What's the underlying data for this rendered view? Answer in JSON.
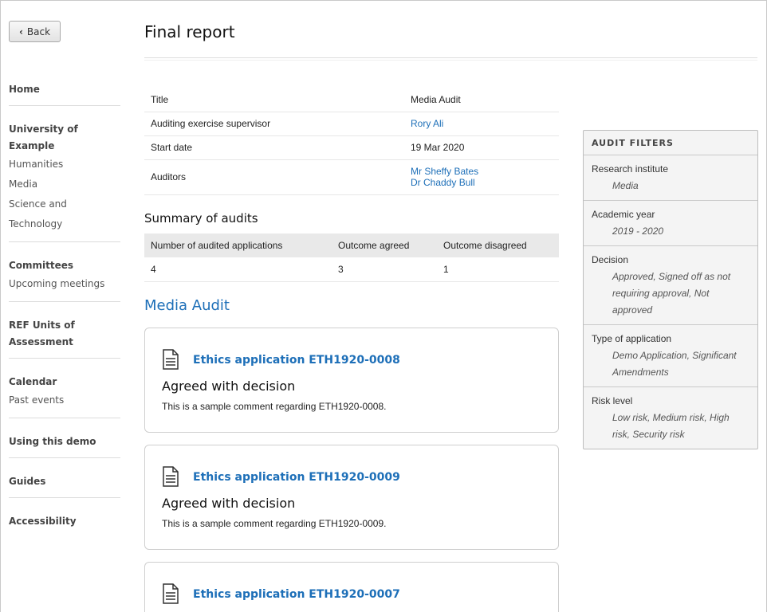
{
  "back": {
    "label": "Back"
  },
  "sidebar": {
    "home": "Home",
    "university": {
      "heading": "University of Example",
      "links": [
        "Humanities",
        "Media",
        "Science and Technology"
      ]
    },
    "committees": {
      "heading": "Committees",
      "links": [
        "Upcoming meetings"
      ]
    },
    "ref_units": "REF Units of Assessment",
    "calendar": {
      "heading": "Calendar",
      "links": [
        "Past events"
      ]
    },
    "using_demo": "Using this demo",
    "guides": "Guides",
    "accessibility": "Accessibility"
  },
  "page": {
    "title": "Final report"
  },
  "details": {
    "title_label": "Title",
    "title_value": "Media Audit",
    "supervisor_label": "Auditing exercise supervisor",
    "supervisor_value": "Rory Ali",
    "start_label": "Start date",
    "start_value": "19 Mar 2020",
    "auditors_label": "Auditors",
    "auditors": [
      "Mr Sheffy Bates",
      "Dr Chaddy Bull"
    ]
  },
  "summary": {
    "heading": "Summary of audits",
    "columns": [
      "Number of audited applications",
      "Outcome agreed",
      "Outcome disagreed"
    ],
    "row": [
      "4",
      "3",
      "1"
    ]
  },
  "section": {
    "heading": "Media Audit"
  },
  "cards": [
    {
      "link": "Ethics application ETH1920-0008",
      "status": "Agreed with decision",
      "comment": "This is a sample comment regarding ETH1920-0008."
    },
    {
      "link": "Ethics application ETH1920-0009",
      "status": "Agreed with decision",
      "comment": "This is a sample comment regarding ETH1920-0009."
    },
    {
      "link": "Ethics application ETH1920-0007",
      "status": "",
      "comment": ""
    }
  ],
  "filters": {
    "heading": "AUDIT FILTERS",
    "items": [
      {
        "label": "Research institute",
        "value": "Media"
      },
      {
        "label": "Academic year",
        "value": "2019 - 2020"
      },
      {
        "label": "Decision",
        "value": "Approved, Signed off as not requiring approval, Not approved"
      },
      {
        "label": "Type of application",
        "value": "Demo Application, Significant Amendments"
      },
      {
        "label": "Risk level",
        "value": "Low risk, Medium risk, High risk, Security risk"
      }
    ]
  },
  "colors": {
    "link": "#1d6fb8",
    "panel_bg": "#f4f4f4",
    "table_header_bg": "#e9e9e9"
  },
  "icons": {
    "back": "chevron-left-icon",
    "card": "document-icon"
  }
}
